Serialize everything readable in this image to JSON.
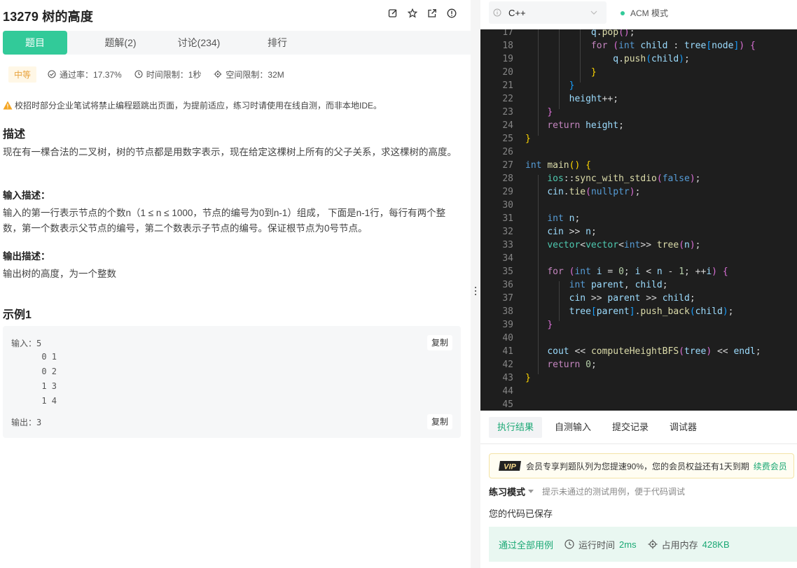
{
  "problem": {
    "title": "13279  树的高度",
    "icons": [
      "edit-icon",
      "star-icon",
      "share-icon",
      "report-icon"
    ]
  },
  "tabs": [
    "题目",
    "题解(2)",
    "讨论(234)",
    "排行"
  ],
  "meta": {
    "difficulty": "中等",
    "pass_rate": "通过率：17.37%",
    "time_limit": "时间限制：1秒",
    "space_limit": "空间限制：32M"
  },
  "notice": "校招时部分企业笔试将禁止编程题跳出页面，为提前适应，练习时请使用在线自测，而非本地IDE。",
  "description": {
    "heading": "描述",
    "text": "现在有一棵合法的二叉树，树的节点都是用数字表示，现在给定这棵树上所有的父子关系，求这棵树的高度。",
    "input_heading": "输入描述：",
    "input_text": "输入的第一行表示节点的个数n（1 ≤ n ≤ 1000，节点的编号为0到n-1）组成， 下面是n-1行，每行有两个整数，第一个数表示父节点的编号，第二个数表示子节点的编号。保证根节点为0号节点。",
    "output_heading": "输出描述：",
    "output_text": "输出树的高度，为一个整数"
  },
  "example": {
    "heading": "示例1",
    "input_lines": [
      "输入：5",
      "      0 1",
      "      0 2",
      "      1 3",
      "      1 4"
    ],
    "output_line": "输出：3",
    "copy_label": "复制"
  },
  "editor": {
    "language": "C++",
    "mode": "ACM 模式",
    "line_numbers": [
      "17",
      "18",
      "19",
      "20",
      "21",
      "22",
      "23",
      "24",
      "25",
      "26",
      "27",
      "28",
      "29",
      "30",
      "31",
      "32",
      "33",
      "34",
      "35",
      "36",
      "37",
      "38",
      "39",
      "40",
      "41",
      "42",
      "43",
      "44",
      "45"
    ]
  },
  "result_tabs": [
    "执行结果",
    "自测输入",
    "提交记录",
    "调试器"
  ],
  "vip": {
    "badge": "VIP",
    "text": "会员专享判题队列为您提速90%，您的会员权益还有1天到期",
    "renew": "续费会员"
  },
  "practice": {
    "mode": "练习模式",
    "hint": "提示未通过的测试用例，便于代码调试"
  },
  "saved_text": "您的代码已保存",
  "result": {
    "status": "通过全部用例",
    "runtime_label": "运行时间",
    "runtime_value": "2ms",
    "memory_label": "占用内存",
    "memory_value": "428KB"
  },
  "colors": {
    "accent": "#32ca99",
    "accent_text": "#1aa874",
    "editor_bg": "#1e1e1e"
  }
}
